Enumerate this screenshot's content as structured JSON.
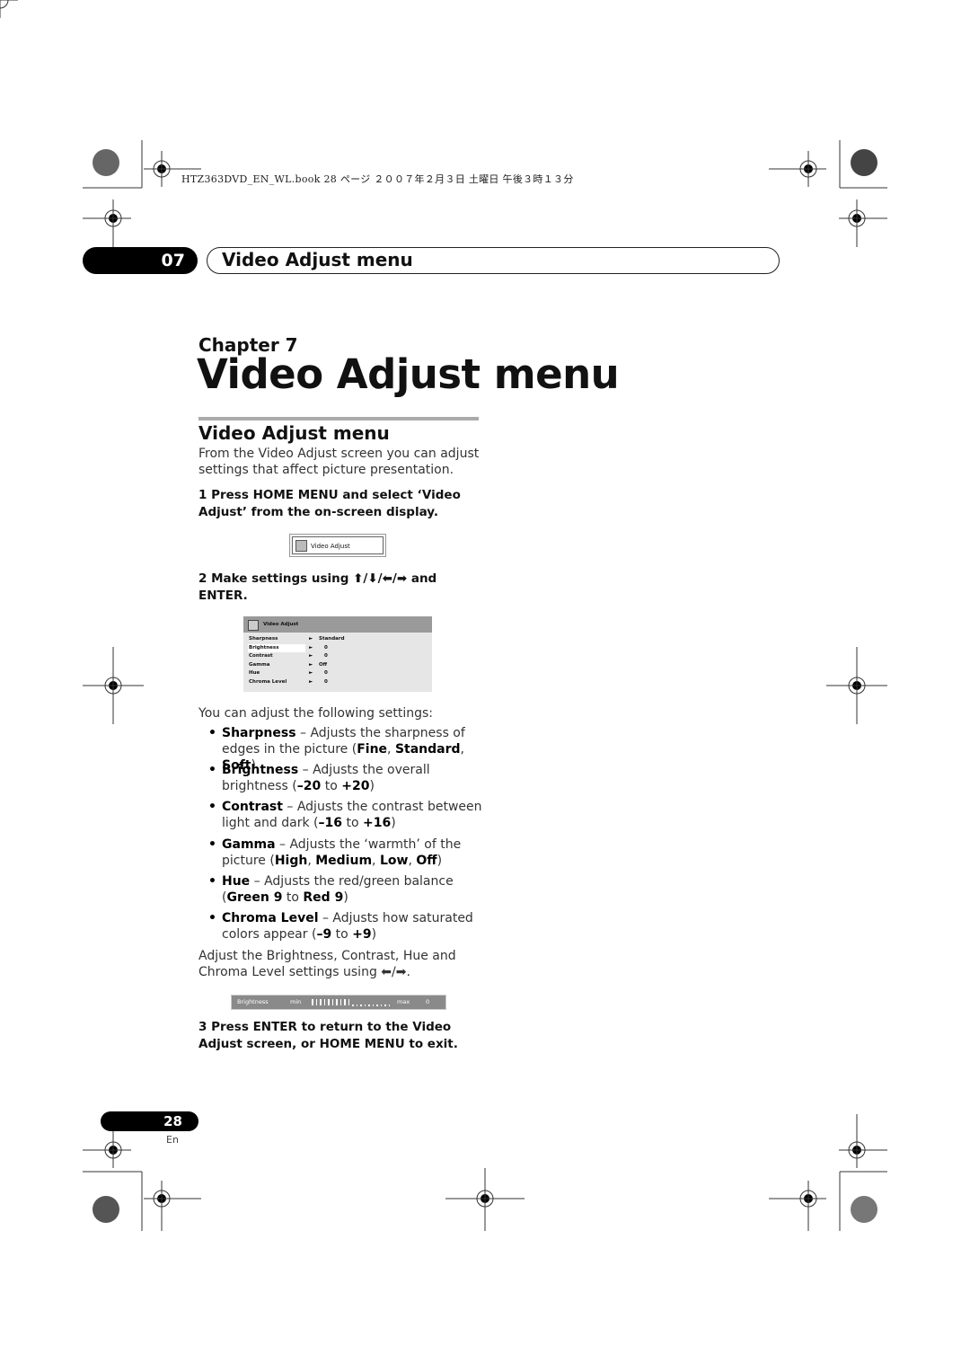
{
  "header_line": "HTZ363DVD_EN_WL.book  28 ページ  ２００７年２月３日  土曜日  午後３時１３分",
  "chapter_tab": {
    "number": "07",
    "title": "Video Adjust menu"
  },
  "chapter_label": "Chapter 7",
  "chapter_title": "Video Adjust menu",
  "section_title": "Video Adjust menu",
  "intro": "From the Video Adjust screen you can adjust settings that affect picture presentation.",
  "step1": "1   Press HOME MENU and select ‘Video Adjust’ from the on-screen display.",
  "osd_button": "Video Adjust",
  "step2": "2   Make settings using ⬆/⬇/⬅/➡ and ENTER.",
  "osd_menu": {
    "title": "Video Adjust",
    "selected": "Brightness",
    "rows": [
      {
        "label": "Sharpness",
        "value": "Standard"
      },
      {
        "label": "Brightness",
        "value": "0"
      },
      {
        "label": "Contrast",
        "value": "0"
      },
      {
        "label": "Gamma",
        "value": "Off"
      },
      {
        "label": "Hue",
        "value": "0"
      },
      {
        "label": "Chroma Level",
        "value": "0"
      }
    ]
  },
  "following": "You can adjust the following settings:",
  "bullets": [
    [
      {
        "t": "Sharpness",
        "b": true
      },
      {
        "t": " – Adjusts the sharpness of edges in the picture ("
      },
      {
        "t": "Fine",
        "b": true
      },
      {
        "t": ", "
      },
      {
        "t": "Standard",
        "b": true
      },
      {
        "t": ", "
      },
      {
        "t": "Soft",
        "b": true
      },
      {
        "t": ")"
      }
    ],
    [
      {
        "t": "Brightness",
        "b": true
      },
      {
        "t": " – Adjusts the overall brightness ("
      },
      {
        "t": "–20",
        "b": true
      },
      {
        "t": " to "
      },
      {
        "t": "+20",
        "b": true
      },
      {
        "t": ")"
      }
    ],
    [
      {
        "t": "Contrast",
        "b": true
      },
      {
        "t": " – Adjusts the contrast between light and dark ("
      },
      {
        "t": "–16",
        "b": true
      },
      {
        "t": " to "
      },
      {
        "t": "+16",
        "b": true
      },
      {
        "t": ")"
      }
    ],
    [
      {
        "t": "Gamma",
        "b": true
      },
      {
        "t": " – Adjusts the ‘warmth’ of the picture ("
      },
      {
        "t": "High",
        "b": true
      },
      {
        "t": ", "
      },
      {
        "t": "Medium",
        "b": true
      },
      {
        "t": ", "
      },
      {
        "t": "Low",
        "b": true
      },
      {
        "t": ", "
      },
      {
        "t": "Off",
        "b": true
      },
      {
        "t": ")"
      }
    ],
    [
      {
        "t": "Hue",
        "b": true
      },
      {
        "t": " – Adjusts the red/green balance ("
      },
      {
        "t": "Green 9",
        "b": true
      },
      {
        "t": " to "
      },
      {
        "t": "Red 9",
        "b": true
      },
      {
        "t": ")"
      }
    ],
    [
      {
        "t": "Chroma Level",
        "b": true
      },
      {
        "t": " – Adjusts how saturated colors appear ("
      },
      {
        "t": "–9",
        "b": true
      },
      {
        "t": " to "
      },
      {
        "t": "+9",
        "b": true
      },
      {
        "t": ")"
      }
    ]
  ],
  "adjust_note": "Adjust the Brightness, Contrast, Hue and Chroma Level settings using ⬅/➡.",
  "slider": {
    "label": "Brightness",
    "min": "min",
    "max": "max",
    "value": "0",
    "level": 0.5
  },
  "step3": "3   Press ENTER to return to the Video Adjust screen, or HOME MENU to exit.",
  "page_number": "28",
  "lang": "En"
}
